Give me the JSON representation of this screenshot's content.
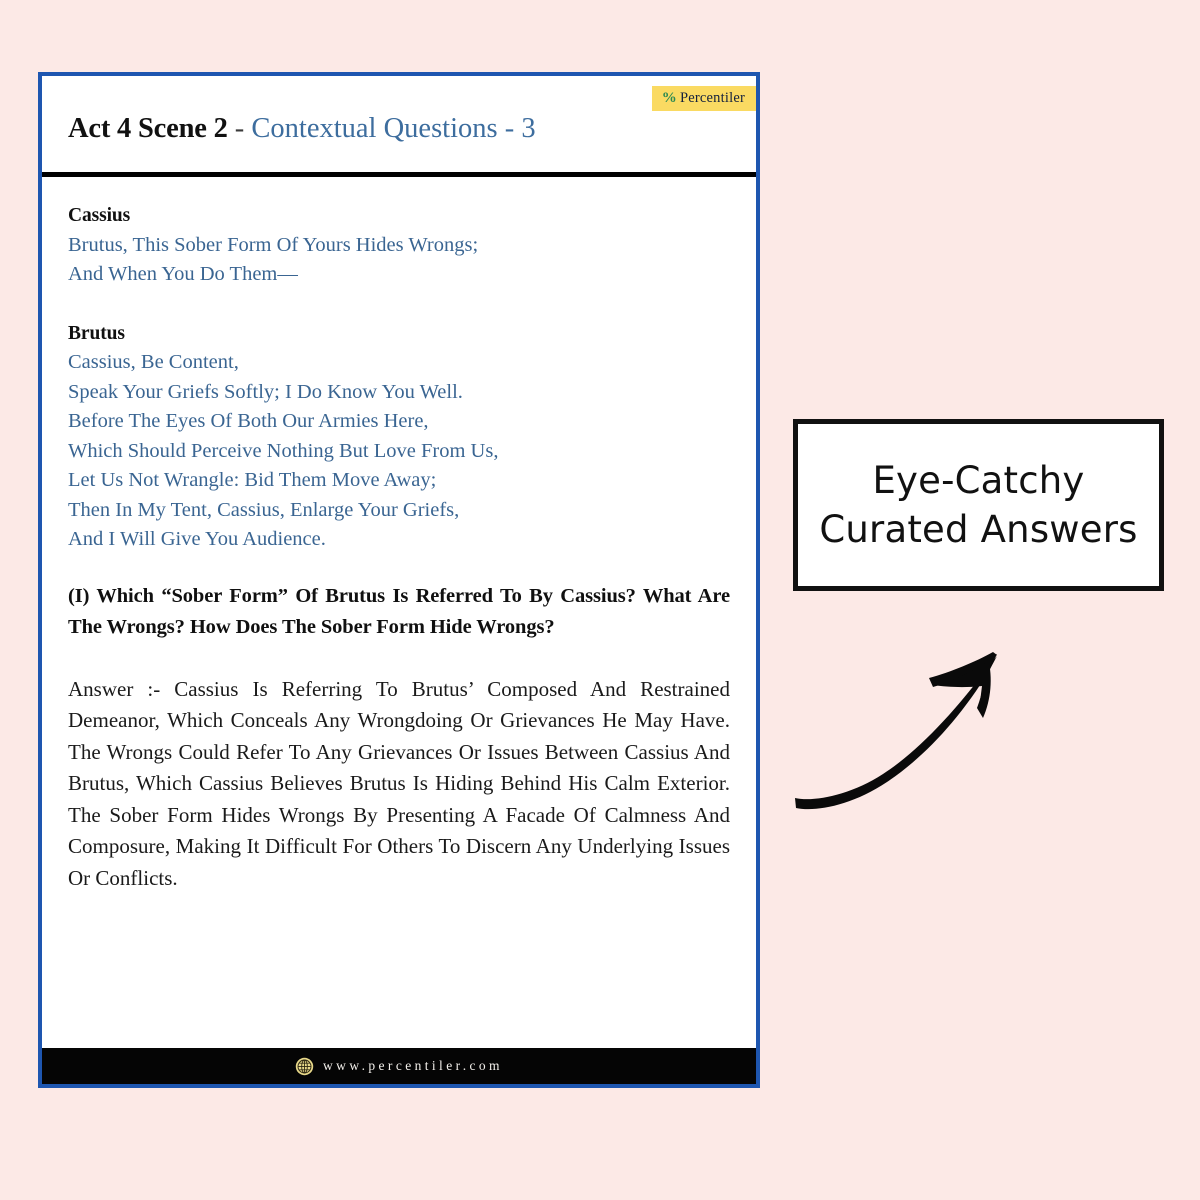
{
  "page": {
    "background_color": "#fce9e6"
  },
  "card": {
    "border_color": "#1e56b0",
    "badge": {
      "icon": "percent-icon",
      "symbol": "%",
      "label": "Percentiler",
      "background_color": "#fada62",
      "symbol_color": "#2d8a52"
    },
    "title": {
      "bold_part": "Act 4 Scene 2",
      "separator": " - ",
      "rest": "Contextual Questions - 3",
      "accent_color": "#3d6d9e"
    },
    "speeches": [
      {
        "speaker": "Cassius",
        "lines": [
          "Brutus, This Sober Form Of Yours Hides Wrongs;",
          "And When You Do Them—"
        ]
      },
      {
        "speaker": "Brutus",
        "lines": [
          "Cassius, Be Content,",
          "Speak Your Griefs Softly; I Do Know You Well.",
          "Before The Eyes Of Both Our Armies Here,",
          "Which Should Perceive Nothing But Love From Us,",
          "Let Us Not Wrangle: Bid Them Move Away;",
          "Then In My Tent, Cassius, Enlarge Your Griefs,",
          "And I Will Give You Audience."
        ]
      }
    ],
    "question": "(I) Which “Sober Form” Of Brutus Is Referred To By Cassius? What Are The Wrongs? How Does The Sober Form Hide Wrongs?",
    "answer": "Answer :- Cassius Is Referring To Brutus’ Composed And Restrained Demeanor, Which Conceals Any Wrongdoing Or Grievances He May Have. The Wrongs Could Refer To Any Grievances Or Issues Between Cassius And Brutus, Which Cassius Believes Brutus Is Hiding Behind His Calm Exterior. The Sober Form Hides Wrongs By Presenting A Facade Of Calmness And Composure, Making It Difficult For Others To Discern Any Underlying Issues Or Conflicts.",
    "footer": {
      "icon": "globe-icon",
      "url": "www.percentiler.com",
      "background_color": "#050505",
      "icon_color": "#e8d98a"
    }
  },
  "callout": {
    "line1": "Eye-Catchy",
    "line2": "Curated Answers",
    "arrow_icon": "curved-arrow-up-right-icon"
  }
}
